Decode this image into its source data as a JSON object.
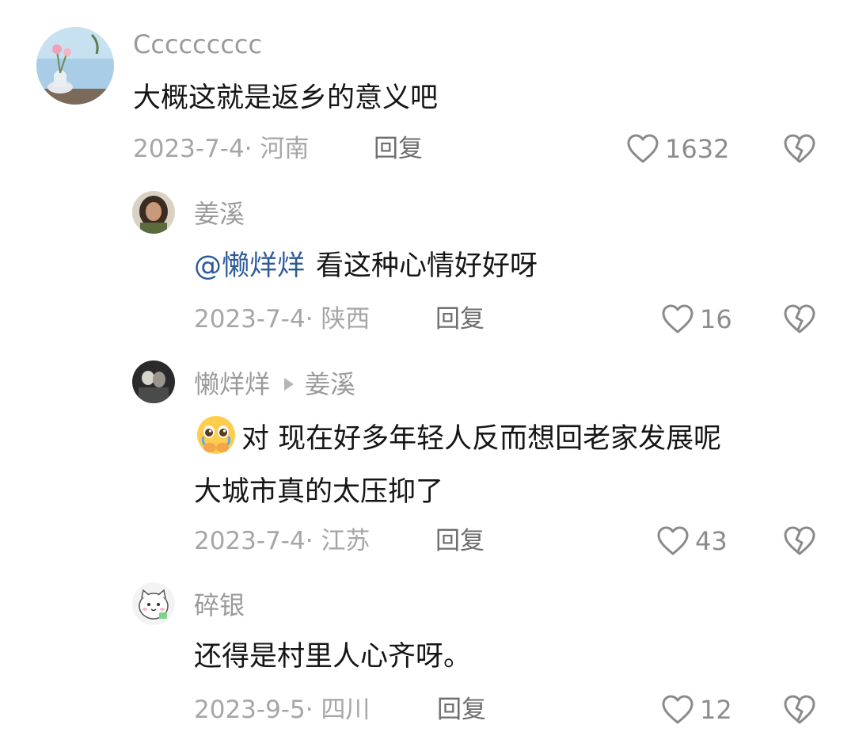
{
  "comments": [
    {
      "username": "Ccccccccc",
      "text": "大概这就是返乡的意义吧",
      "date": "2023-7-4",
      "location": "河南",
      "reply_label": "回复",
      "likes": "1632",
      "avatar_icon": "flower-vase-avatar"
    },
    {
      "username": "姜溪",
      "mention": "@懒烊烊",
      "text": "看这种心情好好呀",
      "date": "2023-7-4",
      "location": "陕西",
      "reply_label": "回复",
      "likes": "16",
      "avatar_icon": "girl-portrait-avatar"
    },
    {
      "username": "懒烊烊",
      "reply_to": "姜溪",
      "emoji": "pleading-face-emoji",
      "text_line1": "对 现在好多年轻人反而想回老家发展呢",
      "text_line2": "大城市真的太压抑了",
      "date": "2023-7-4",
      "location": "江苏",
      "reply_label": "回复",
      "likes": "43",
      "avatar_icon": "dark-portrait-avatar"
    },
    {
      "username": "碎银",
      "text": "还得是村里人心齐呀。",
      "date": "2023-9-5",
      "location": "四川",
      "reply_label": "回复",
      "likes": "12",
      "avatar_icon": "cartoon-cat-avatar"
    }
  ],
  "colors": {
    "username": "#9a9a9a",
    "text": "#161616",
    "mention": "#2d5a9b",
    "meta": "#a6a6a6",
    "reply": "#6e6e6e",
    "icon": "#8a8a8a"
  }
}
